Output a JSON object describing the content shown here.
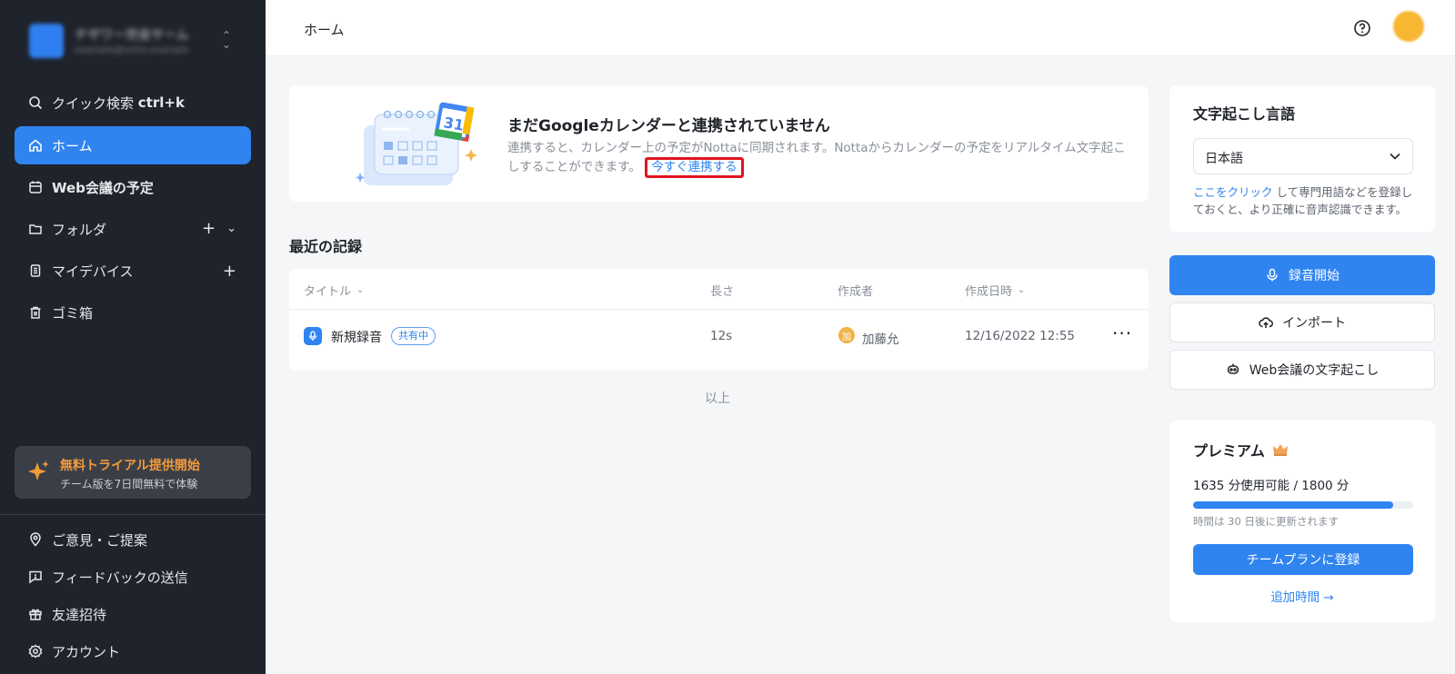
{
  "sidebar": {
    "workspace_name": "チザワー労会サーム",
    "workspace_sub": "example@notta.example",
    "search": {
      "label": "クイック検索",
      "shortcut": "ctrl+k"
    },
    "items": [
      {
        "label": "ホーム",
        "icon": "home-icon"
      },
      {
        "label": "Web会議の予定",
        "icon": "calendar-icon"
      },
      {
        "label": "フォルダ",
        "icon": "folder-icon"
      },
      {
        "label": "マイデバイス",
        "icon": "device-icon"
      },
      {
        "label": "ゴミ箱",
        "icon": "trash-icon"
      }
    ],
    "trial": {
      "title": "無料トライアル提供開始",
      "subtitle": "チーム版を7日間無料で体験"
    },
    "bottom": [
      {
        "label": "ご意見・ご提案",
        "icon": "location-icon"
      },
      {
        "label": "フィードバックの送信",
        "icon": "feedback-icon"
      },
      {
        "label": "友達招待",
        "icon": "gift-icon"
      },
      {
        "label": "アカウント",
        "icon": "gear-icon"
      }
    ]
  },
  "header": {
    "title": "ホーム"
  },
  "banner": {
    "title": "まだGoogleカレンダーと連携されていません",
    "desc": "連携すると、カレンダー上の予定がNottaに同期されます。Nottaからカレンダーの予定をリアルタイム文字起こしすることができます。",
    "link": "今すぐ連携する",
    "calendar_number": "31"
  },
  "recent": {
    "title": "最近の記録",
    "columns": {
      "title": "タイトル",
      "length": "長さ",
      "creator": "作成者",
      "created": "作成日時"
    },
    "rows": [
      {
        "title": "新規録音",
        "badge": "共有中",
        "length": "12s",
        "creator_initial": "加",
        "creator": "加藤允",
        "created": "12/16/2022 12:55"
      }
    ],
    "end": "以上"
  },
  "language": {
    "title": "文字起こし言語",
    "value": "日本語",
    "note_link": "ここをクリック",
    "note_text": " して専門用語などを登録しておくと、より正確に音声認識できます。"
  },
  "actions": {
    "record": "録音開始",
    "import": "インポート",
    "meeting": "Web会議の文字起こし"
  },
  "premium": {
    "title": "プレミアム",
    "usage": "1635 分使用可能 / 1800 分",
    "usage_fraction": 0.908,
    "renew": "時間は 30 日後に更新されます",
    "team_button": "チームプランに登録",
    "add_time": "追加時間 →"
  },
  "colors": {
    "accent": "#2f84f0",
    "sidebar": "#1f232b",
    "trial": "#f39a3a",
    "highlight": "#e0141e"
  }
}
